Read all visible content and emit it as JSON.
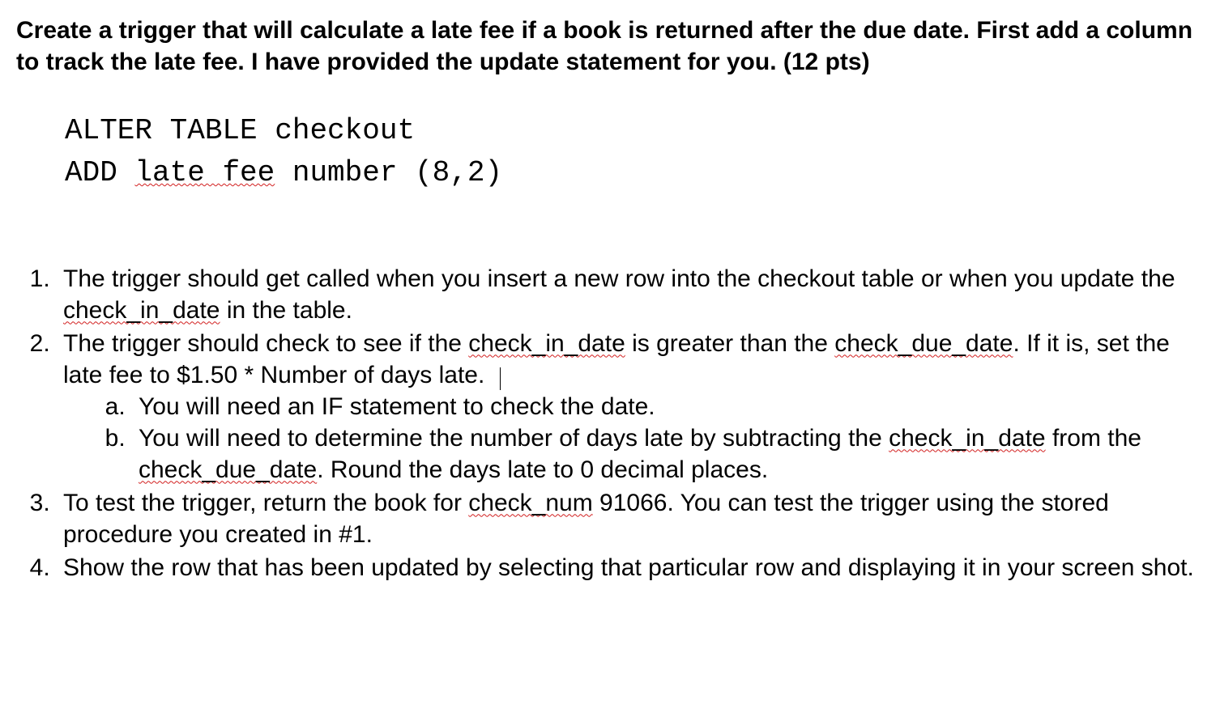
{
  "heading": "Create a trigger that will calculate a late fee if a book is returned after the due date.  First add a column to track the late fee.  I have provided the update statement for you.  (12 pts)",
  "code": {
    "line1": "ALTER TABLE checkout",
    "line2a": "ADD ",
    "line2_sq": "late fee",
    "line2b": " number (8,2)"
  },
  "list": {
    "li1a": "The trigger should get called when you insert a new row into the checkout table or when you update the ",
    "li1_sq1": "check_in_date",
    "li1b": " in the table.",
    "li2a": "The trigger should check to see if the ",
    "li2_sq1": "check_in_date",
    "li2b": " is greater than the ",
    "li2_sq2": "check_due_date",
    "li2c": ".  If it is, set the late fee to $1.50 * Number of days late.  ",
    "li2_sub_a": "You will need an IF statement to check the date.",
    "li2_sub_b_a": "You will need to determine the number of days late by subtracting the ",
    "li2_sub_b_sq1": "check_in_date",
    "li2_sub_b_b": " from the ",
    "li2_sub_b_sq2": "check_due_date",
    "li2_sub_b_c": ".  Round the days late to 0 decimal places.",
    "li3a": "To test the trigger, return the book for ",
    "li3_sq1": "check_num",
    "li3b": " 91066.  You can test the trigger using the stored procedure you created in #1.",
    "li4": "Show the row that has been updated by selecting that particular row and displaying it in your screen shot."
  }
}
